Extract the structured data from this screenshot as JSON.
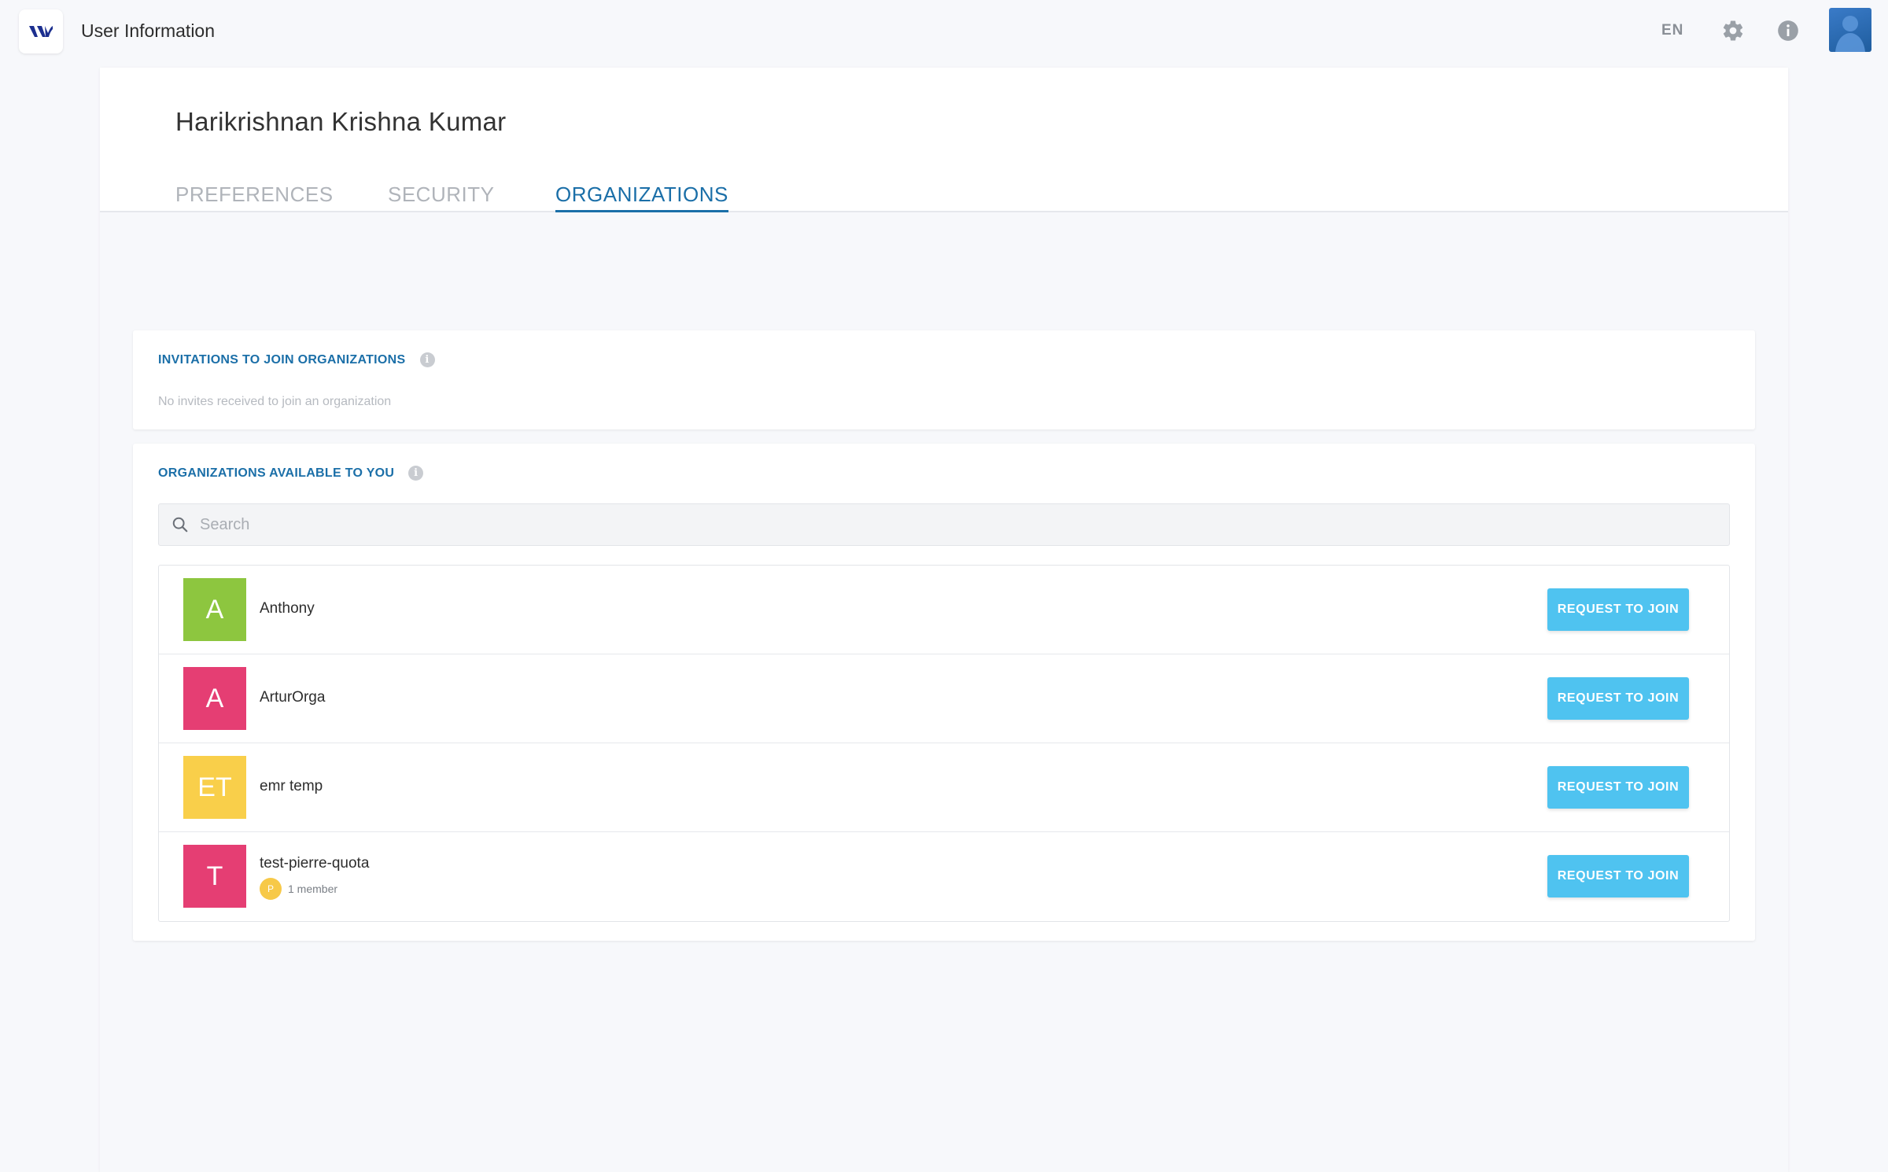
{
  "header": {
    "app_title": "User Information",
    "language": "EN",
    "icons": {
      "logo": "app-logo-icon",
      "settings": "gear-icon",
      "info": "info-icon",
      "avatar": "user-avatar"
    }
  },
  "profile": {
    "name": "Harikrishnan Krishna Kumar"
  },
  "tabs": [
    {
      "label": "PREFERENCES",
      "active": false
    },
    {
      "label": "SECURITY",
      "active": false
    },
    {
      "label": "ORGANIZATIONS",
      "active": true
    }
  ],
  "invitations": {
    "heading": "INVITATIONS TO JOIN ORGANIZATIONS",
    "empty_text": "No invites received to join an organization"
  },
  "available": {
    "heading": "ORGANIZATIONS AVAILABLE TO YOU",
    "search_placeholder": "Search",
    "join_label": "REQUEST TO JOIN",
    "orgs": [
      {
        "initials": "A",
        "name": "Anthony",
        "color": "#8dc63f",
        "meta": ""
      },
      {
        "initials": "A",
        "name": "ArturOrga",
        "color": "#e53e73",
        "meta": ""
      },
      {
        "initials": "ET",
        "name": "emr temp",
        "color": "#f9cf4a",
        "meta": ""
      },
      {
        "initials": "T",
        "name": "test-pierre-quota",
        "color": "#e53e73",
        "meta": "1 member",
        "member_initial": "P"
      }
    ]
  },
  "colors": {
    "accent": "#1b6fa8",
    "button": "#4fc3f0"
  }
}
